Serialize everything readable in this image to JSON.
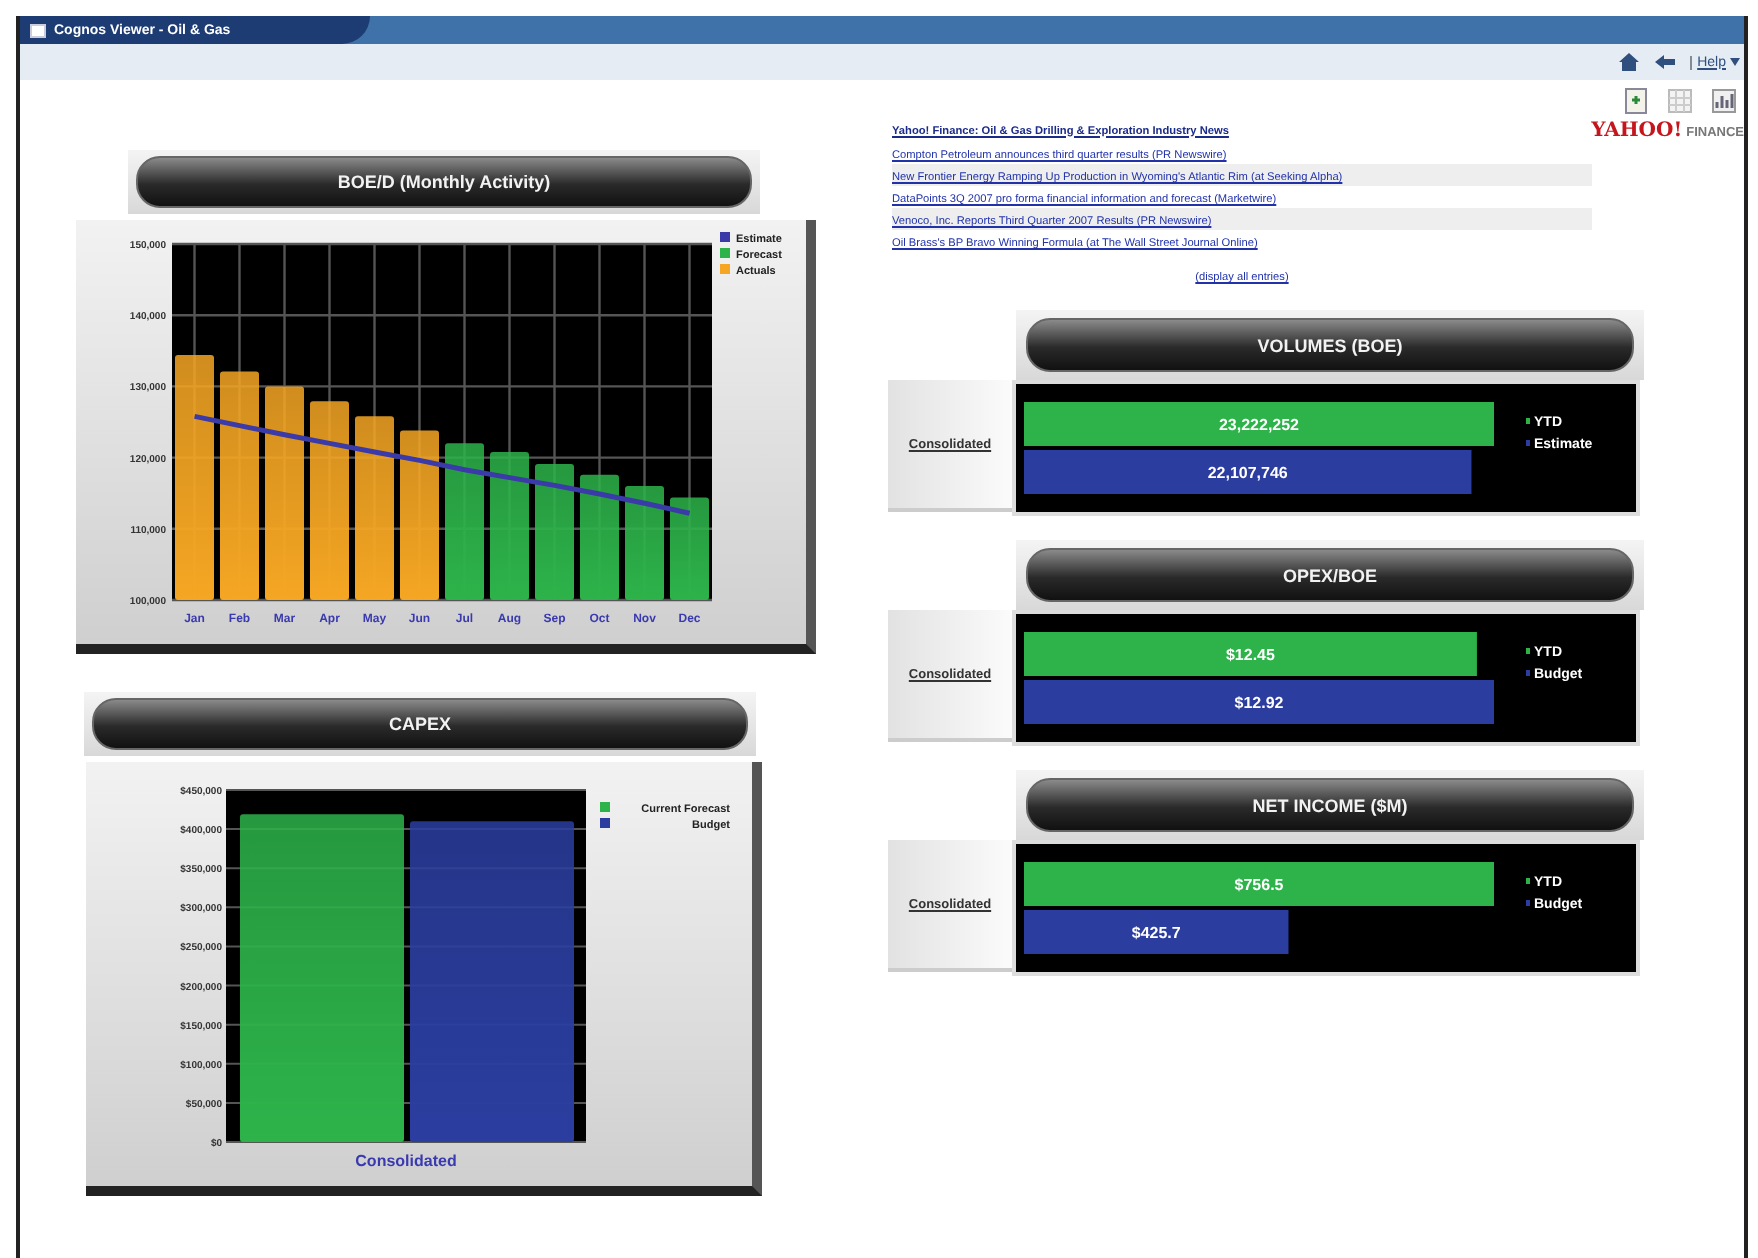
{
  "window": {
    "title": "Cognos Viewer - Oil & Gas"
  },
  "toolbar": {
    "help": "Help"
  },
  "left_panels": [
    {
      "title": "BOE/D (Monthly Activity)",
      "chart_data": {
        "type": "bar",
        "categories": [
          "Jan",
          "Feb",
          "Mar",
          "Apr",
          "May",
          "Jun",
          "Jul",
          "Aug",
          "Sep",
          "Oct",
          "Nov",
          "Dec"
        ],
        "series": [
          {
            "name": "Estimate",
            "type": "line",
            "color": "#3a3aa8",
            "values": [
              125800,
              124500,
              123200,
              122000,
              120800,
              119600,
              118300,
              117200,
              116100,
              114900,
              113600,
              112200
            ]
          },
          {
            "name": "Forecast",
            "type": "bar",
            "color": "#2db34a",
            "values": [
              null,
              null,
              null,
              null,
              null,
              null,
              122000,
              120800,
              119100,
              117600,
              116000,
              114400
            ]
          },
          {
            "name": "Actuals",
            "type": "bar",
            "color": "#f5a623",
            "values": [
              134400,
              132100,
              130000,
              127900,
              125800,
              123800,
              null,
              null,
              null,
              null,
              null,
              null
            ]
          }
        ],
        "grid": true,
        "legend": "right",
        "ylim": [
          100000,
          150000
        ],
        "yticks": [
          {
            "value": 100000,
            "label": "100,000"
          },
          {
            "value": 110000,
            "label": "110,000"
          },
          {
            "value": 120000,
            "label": "120,000"
          },
          {
            "value": 130000,
            "label": "130,000"
          },
          {
            "value": 140000,
            "label": "140,000"
          },
          {
            "value": 150000,
            "label": "150,000"
          }
        ]
      }
    },
    {
      "title": "CAPEX",
      "chart_data": {
        "type": "bar",
        "categories": [
          "Consolidated"
        ],
        "series": [
          {
            "name": "Current Forecast",
            "type": "bar",
            "color": "#2db34a",
            "values": [
              419000
            ]
          },
          {
            "name": "Budget",
            "type": "bar",
            "color": "#2b3ea0",
            "values": [
              410000
            ]
          }
        ],
        "grid": true,
        "legend": "right",
        "ylim": [
          0,
          450000
        ],
        "yticks": [
          {
            "value": 0,
            "label": "$0"
          },
          {
            "value": 50000,
            "label": "$50,000"
          },
          {
            "value": 100000,
            "label": "$100,000"
          },
          {
            "value": 150000,
            "label": "$150,000"
          },
          {
            "value": 200000,
            "label": "$200,000"
          },
          {
            "value": 250000,
            "label": "$250,000"
          },
          {
            "value": 300000,
            "label": "$300,000"
          },
          {
            "value": 350000,
            "label": "$350,000"
          },
          {
            "value": 400000,
            "label": "$400,000"
          },
          {
            "value": 450000,
            "label": "$450,000"
          }
        ]
      }
    }
  ],
  "news": {
    "heading": "Yahoo! Finance: Oil & Gas Drilling & Exploration Industry News",
    "logo_brand": "YAHOO!",
    "logo_sub": "FINANCE",
    "items": [
      "Compton Petroleum announces third quarter results (PR Newswire)",
      "New Frontier Energy Ramping Up Production in Wyoming's Atlantic Rim (at Seeking Alpha)",
      "DataPoints 3Q 2007 pro forma financial information and forecast (Marketwire)",
      "Venoco, Inc. Reports Third Quarter 2007 Results (PR Newswire)",
      "Oil Brass's BP Bravo Winning Formula (at The Wall Street Journal Online)"
    ],
    "more": "(display all entries)"
  },
  "kpis": [
    {
      "title": "VOLUMES (BOE)",
      "chart_data": {
        "type": "bar",
        "orientation": "horizontal",
        "categories": [
          "Consolidated"
        ],
        "series": [
          {
            "name": "YTD",
            "color": "#2db34a",
            "values": [
              23222252
            ],
            "value_labels": [
              "23,222,252"
            ]
          },
          {
            "name": "Estimate",
            "color": "#2b3ea0",
            "values": [
              22107746
            ],
            "value_labels": [
              "22,107,746"
            ]
          }
        ],
        "legend": "right"
      }
    },
    {
      "title": "OPEX/BOE",
      "chart_data": {
        "type": "bar",
        "orientation": "horizontal",
        "categories": [
          "Consolidated"
        ],
        "series": [
          {
            "name": "YTD",
            "color": "#2db34a",
            "values": [
              12.45
            ],
            "value_labels": [
              "$12.45"
            ]
          },
          {
            "name": "Budget",
            "color": "#2b3ea0",
            "values": [
              12.92
            ],
            "value_labels": [
              "$12.92"
            ]
          }
        ],
        "legend": "right"
      }
    },
    {
      "title": "NET INCOME ($M)",
      "chart_data": {
        "type": "bar",
        "orientation": "horizontal",
        "categories": [
          "Consolidated"
        ],
        "series": [
          {
            "name": "YTD",
            "color": "#2db34a",
            "values": [
              756.5
            ],
            "value_labels": [
              "$756.5"
            ]
          },
          {
            "name": "Budget",
            "color": "#2b3ea0",
            "values": [
              425.7
            ],
            "value_labels": [
              "$425.7"
            ]
          }
        ],
        "legend": "right"
      }
    }
  ]
}
